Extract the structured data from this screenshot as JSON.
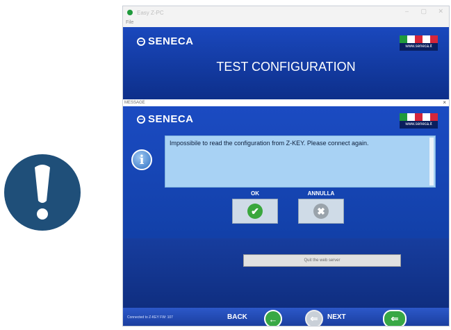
{
  "window": {
    "title": "Easy Z-PC",
    "menu": "File"
  },
  "header": {
    "logo_text": "SENECA",
    "website": "www.seneca.it",
    "title": "TEST CONFIGURATION"
  },
  "message_bar": {
    "label": "MESSAGE",
    "close": "×"
  },
  "dialog": {
    "logo_text": "SENECA",
    "website": "www.seneca.it",
    "info_icon": "i",
    "message": "Impossibile to read the configuration from Z-KEY. Please connect again.",
    "ok_label": "OK",
    "cancel_label": "ANNULLA",
    "ok_icon": "✔",
    "cancel_icon": "✖"
  },
  "exit_button": "Quit the web server",
  "footer": {
    "status": "Connected to Z-KEY FW: 107",
    "back_label": "BACK",
    "next_label": "NEXT",
    "back_icon": "←",
    "next_icon": "⇐",
    "forward_icon": "⇐"
  },
  "warning_icon": "exclamation-mark",
  "colors": {
    "brand_blue": "#0f2f86",
    "warning_navy": "#1f4f79",
    "ok_green": "#3aa73d",
    "cancel_grey": "#9aa3ab",
    "nav_green": "#38a845"
  }
}
